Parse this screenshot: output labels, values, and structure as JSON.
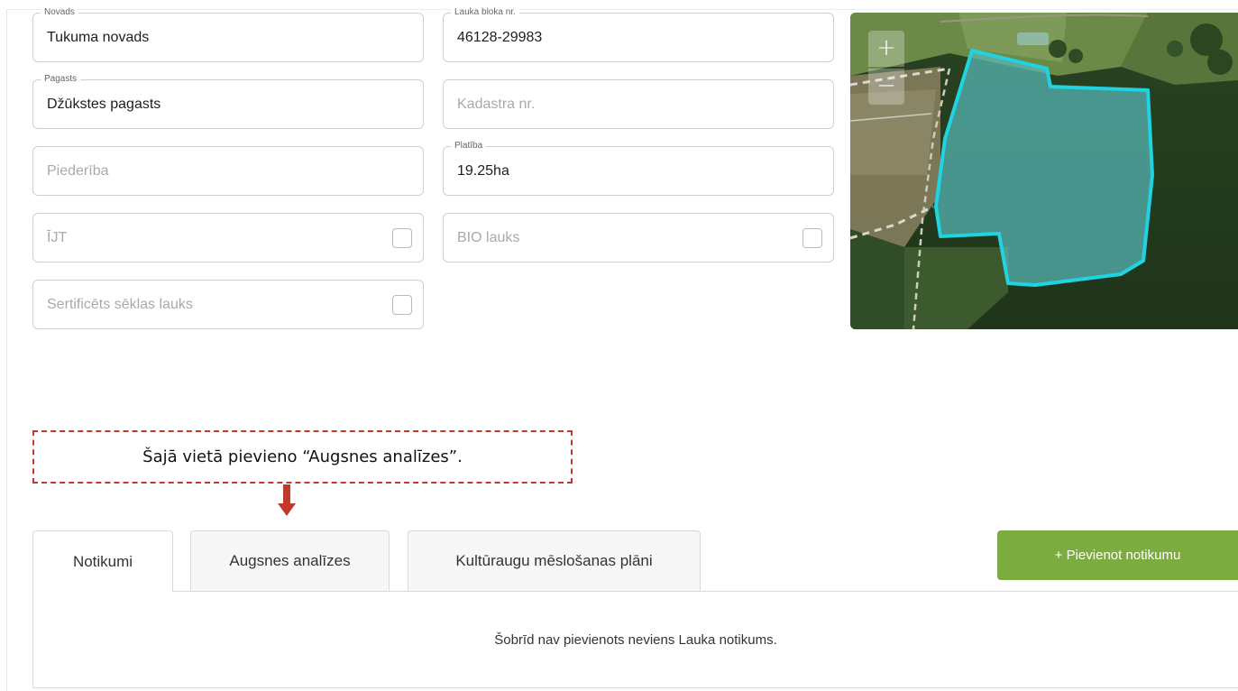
{
  "form": {
    "novads": {
      "label": "Novads",
      "value": "Tukuma novads"
    },
    "lauka_bloka_nr": {
      "label": "Lauka bloka nr.",
      "value": "46128-29983"
    },
    "pagasts": {
      "label": "Pagasts",
      "value": "Džūkstes pagasts"
    },
    "kadastra_nr": {
      "placeholder": "Kadastra nr."
    },
    "piederiba": {
      "placeholder": "Piederība"
    },
    "platiba": {
      "label": "Platība",
      "value": "19.25ha"
    },
    "ijt": {
      "placeholder": "ĪJT",
      "checked": false
    },
    "bio_lauks": {
      "placeholder": "BIO lauks",
      "checked": false
    },
    "sertificets": {
      "placeholder": "Sertificēts sēklas lauks",
      "checked": false
    }
  },
  "map": {
    "zoom_in": "+",
    "zoom_out": "−",
    "field_outline_color": "#1fd3e0"
  },
  "annotation": {
    "text": "Šajā vietā pievieno “Augsnes analīzes”.",
    "color": "#c0392b"
  },
  "tabs": [
    {
      "label": "Notikumi",
      "active": true
    },
    {
      "label": "Augsnes analīzes",
      "active": false
    },
    {
      "label": "Kultūraugu mēslošanas plāni",
      "active": false
    }
  ],
  "add_button": {
    "label": "+ Pievienot notikumu",
    "color": "#7cac3f"
  },
  "empty_state": "Šobrīd nav pievienots neviens Lauka notikums."
}
